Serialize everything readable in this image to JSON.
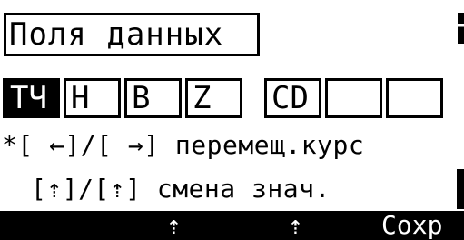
{
  "screen": {
    "title": "Поля данных"
  },
  "fields": [
    {
      "label": "ТЧ",
      "selected": true
    },
    {
      "label": "Н",
      "selected": false
    },
    {
      "label": "В",
      "selected": false
    },
    {
      "label": "Z",
      "selected": false
    },
    {
      "label": "CD",
      "selected": false
    },
    {
      "label": "",
      "selected": false
    },
    {
      "label": "",
      "selected": false
    }
  ],
  "hints": {
    "line1": "*[ ←]/[ →] перемещ.курс",
    "line2": "[⇡]/[⇡] смена знач."
  },
  "softkeys": {
    "key1": "⇡",
    "key2": "⇡",
    "key3": "Сохр"
  },
  "icons": {
    "softkey1": "up-arrow-icon",
    "softkey2": "enter-icon"
  }
}
